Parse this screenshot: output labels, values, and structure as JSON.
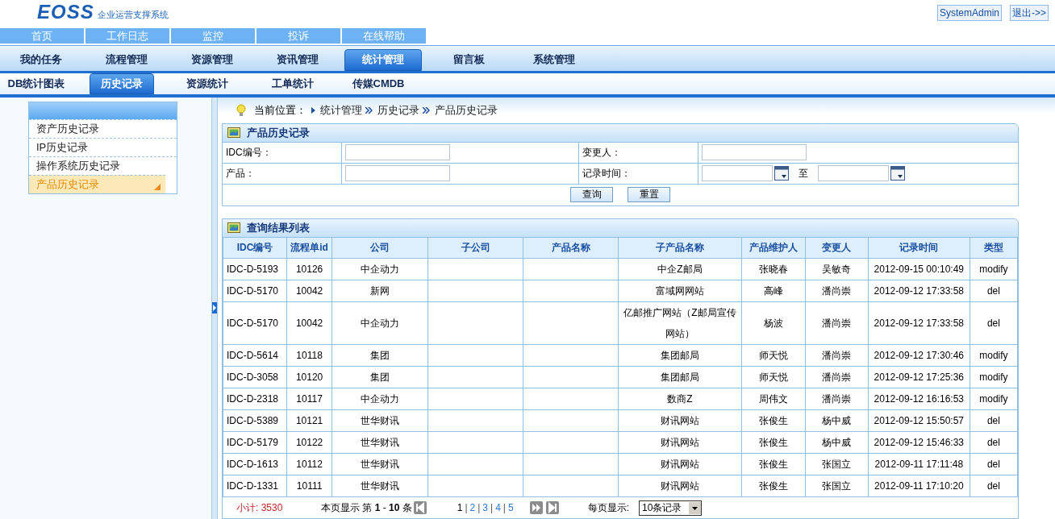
{
  "header": {
    "logo": "EOSS",
    "subtitle": "企业运营支撑系统",
    "user": "SystemAdmin",
    "logout": "退出->>"
  },
  "top_nav": [
    {
      "label": "首页"
    },
    {
      "label": "工作日志"
    },
    {
      "label": "监控"
    },
    {
      "label": "投诉"
    },
    {
      "label": "在线帮助"
    }
  ],
  "main_tabs": [
    {
      "label": "我的任务",
      "selected": false
    },
    {
      "label": "流程管理",
      "selected": false
    },
    {
      "label": "资源管理",
      "selected": false
    },
    {
      "label": "资讯管理",
      "selected": false
    },
    {
      "label": "统计管理",
      "selected": true
    },
    {
      "label": "留言板",
      "selected": false
    },
    {
      "label": "系统管理",
      "selected": false
    }
  ],
  "sub_tabs": [
    {
      "label": "DB统计图表",
      "selected": false
    },
    {
      "label": "历史记录",
      "selected": true
    },
    {
      "label": "资源统计",
      "selected": false
    },
    {
      "label": "工单统计",
      "selected": false
    },
    {
      "label": "传媒CMDB",
      "selected": false
    }
  ],
  "sidebar": {
    "items": [
      {
        "label": "资产历史记录",
        "selected": false
      },
      {
        "label": "IP历史记录",
        "selected": false
      },
      {
        "label": "操作系统历史记录",
        "selected": false
      },
      {
        "label": "产品历史记录",
        "selected": true
      }
    ]
  },
  "breadcrumb": {
    "label": "当前位置：",
    "items": [
      "统计管理",
      "历史记录",
      "产品历史记录"
    ]
  },
  "search_panel": {
    "title": "产品历史记录",
    "fields": [
      {
        "kind": "text",
        "label": "IDC编号："
      },
      {
        "kind": "text",
        "label": "变更人："
      },
      {
        "kind": "text",
        "label": "产品："
      },
      {
        "kind": "date_range",
        "label": "记录时间：",
        "separator": "至"
      }
    ],
    "buttons": [
      "查询",
      "重置"
    ]
  },
  "results": {
    "title": "查询结果列表",
    "columns": [
      "IDC编号",
      "流程单id",
      "公司",
      "子公司",
      "产品名称",
      "子产品名称",
      "产品维护人",
      "变更人",
      "记录时间",
      "类型"
    ],
    "rows": [
      [
        "IDC-D-5193",
        "10126",
        "中企动力",
        "",
        "",
        "中企Z邮局",
        "张晓春",
        "吴敏奇",
        "2012-09-15 00:10:49",
        "modify"
      ],
      [
        "IDC-D-5170",
        "10042",
        "新网",
        "",
        "",
        "富域网网站",
        "高峰",
        "潘尚崇",
        "2012-09-12 17:33:58",
        "del"
      ],
      [
        "IDC-D-5170",
        "10042",
        "中企动力",
        "",
        "",
        "亿邮推广网站（Z邮局宣传网站）",
        "杨波",
        "潘尚崇",
        "2012-09-12 17:33:58",
        "del"
      ],
      [
        "IDC-D-5614",
        "10118",
        "集团",
        "",
        "",
        "集团邮局",
        "师天悦",
        "潘尚崇",
        "2012-09-12 17:30:46",
        "modify"
      ],
      [
        "IDC-D-3058",
        "10120",
        "集团",
        "",
        "",
        "集团邮局",
        "师天悦",
        "潘尚崇",
        "2012-09-12 17:25:36",
        "modify"
      ],
      [
        "IDC-D-2318",
        "10117",
        "中企动力",
        "",
        "",
        "数商Z",
        "周伟文",
        "潘尚崇",
        "2012-09-12 16:16:53",
        "modify"
      ],
      [
        "IDC-D-5389",
        "10121",
        "世华财讯",
        "",
        "",
        "财讯网站",
        "张俊生",
        "杨中威",
        "2012-09-12 15:50:57",
        "del"
      ],
      [
        "IDC-D-5179",
        "10122",
        "世华财讯",
        "",
        "",
        "财讯网站",
        "张俊生",
        "杨中威",
        "2012-09-12 15:46:33",
        "del"
      ],
      [
        "IDC-D-1613",
        "10112",
        "世华财讯",
        "",
        "",
        "财讯网站",
        "张俊生",
        "张国立",
        "2012-09-11 17:11:48",
        "del"
      ],
      [
        "IDC-D-1331",
        "10111",
        "世华财讯",
        "",
        "",
        "财讯网站",
        "张俊生",
        "张国立",
        "2012-09-11 17:10:20",
        "del"
      ]
    ]
  },
  "footer": {
    "total": "小计: 3530",
    "showing": "本页显示 第 **1** - **10** 条",
    "pages": [
      {
        "kind": "page",
        "label": "1",
        "selected": true
      },
      {
        "kind": "separator",
        "label": "|"
      },
      {
        "kind": "page",
        "label": "2",
        "selected": false
      },
      {
        "kind": "separator",
        "label": "|"
      },
      {
        "kind": "page",
        "label": "3",
        "selected": false
      },
      {
        "kind": "separator",
        "label": "|"
      },
      {
        "kind": "page",
        "label": "4",
        "selected": false
      },
      {
        "kind": "separator",
        "label": "|"
      },
      {
        "kind": "page",
        "label": "5",
        "selected": false
      }
    ],
    "per_page_label": "每页显示:",
    "per_page_value": "10条记录"
  }
}
